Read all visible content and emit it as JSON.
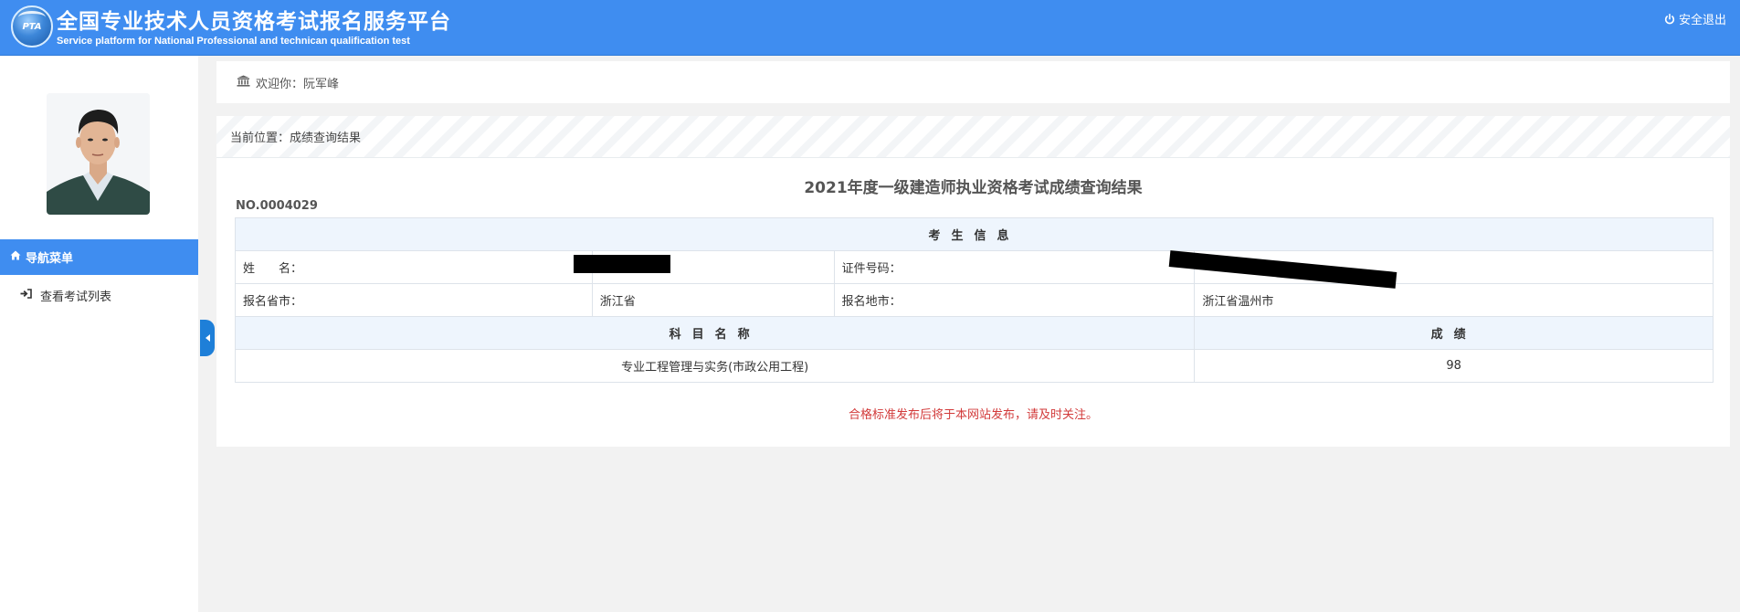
{
  "header": {
    "logo_text": "PTA",
    "title": "全国专业技术人员资格考试报名服务平台",
    "subtitle": "Service platform for National Professional and technican qualification test",
    "logout_label": "安全退出",
    "logout_icon": "power-icon",
    "background_color": "#3f8df0"
  },
  "sidebar": {
    "nav_header": "导航菜单",
    "nav_header_icon": "home-icon",
    "items": [
      {
        "label": "查看考试列表",
        "icon": "sign-in-icon"
      }
    ]
  },
  "welcome": {
    "icon": "institution-icon",
    "text": "欢迎你：阮军峰"
  },
  "breadcrumb": {
    "text": "当前位置：成绩查询结果"
  },
  "result": {
    "title": "2021年度一级建造师执业资格考试成绩查询结果",
    "number": "NO.0004029",
    "candidate_section": "考生信息",
    "labels": {
      "name": "姓　　名：",
      "id_number": "证件号码：",
      "province": "报名省市：",
      "city": "报名地市："
    },
    "values": {
      "province": "浙江省",
      "city": "浙江省温州市"
    },
    "columns": {
      "subject": "科目名称",
      "score": "成绩"
    },
    "rows": [
      {
        "subject": "专业工程管理与实务(市政公用工程)",
        "score": "98"
      }
    ],
    "notice": "合格标准发布后将于本网站发布，请及时关注。",
    "notice_color": "#d23a3a"
  }
}
